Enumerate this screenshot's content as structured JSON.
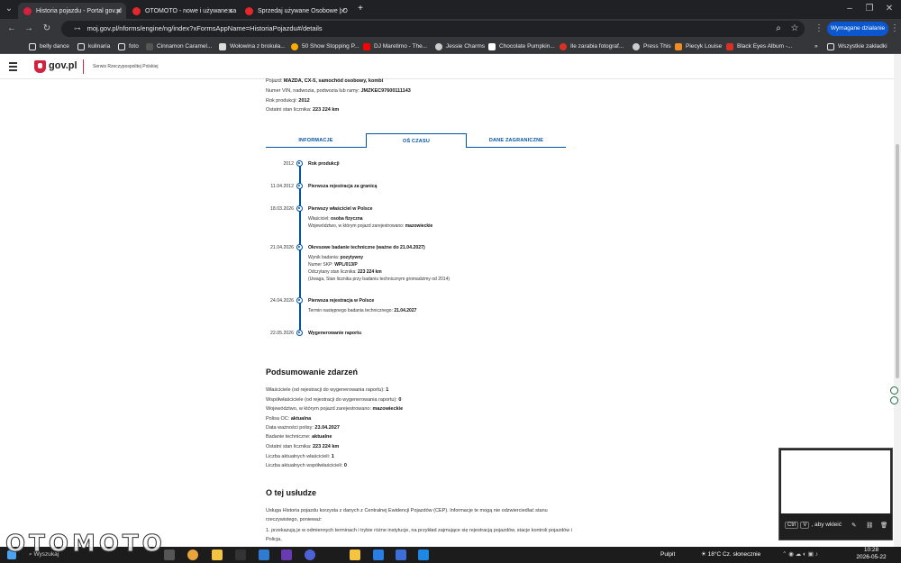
{
  "browser": {
    "tabs": [
      {
        "title": "Historia pojazdu - Portal gov.pl",
        "active": true
      },
      {
        "title": "OTOMOTO - nowe i używane sa",
        "active": false
      },
      {
        "title": "Sprzedaj używane Osobowe | O",
        "active": false
      }
    ],
    "url": "moj.gov.pl/nforms/engine/ng/index?xFormsAppName=HistoriaPojazdu#/details",
    "action_button": "Wymagane działanie",
    "bookmarks": [
      "belly dance",
      "kulinaria",
      "foto",
      "Cinnamon Caramel...",
      "Wołowina z brokuła...",
      "50 Show Stopping P...",
      "DJ Maretimo - The...",
      "Jessie Charms",
      "Chocolate Pumpkin...",
      "Ile zarabia fotograf...",
      "Press This",
      "Piecyk Louise",
      "Black Eyes Album -..."
    ],
    "all_bookmarks": "Wszystkie zakładki"
  },
  "site": {
    "logo": "gov.pl",
    "subtitle": "Serwis Rzeczypospolitej Polskiej"
  },
  "vehicle": {
    "vehicle_label": "Pojazd:",
    "vehicle_value": "MAZDA, CX-5, samochód osobowy, kombi",
    "vin_label": "Numer VIN, nadwozia, podwozia lub ramy:",
    "vin_value": "JMZKEC97600111143",
    "year_label": "Rok produkcji:",
    "year_value": "2012",
    "odometer_label": "Ostatni stan licznika:",
    "odometer_value": "223 224 km"
  },
  "page_tabs": [
    "INFORMACJE",
    "OŚ CZASU",
    "DANE ZAGRANICZNE"
  ],
  "timeline": [
    {
      "date": "2012",
      "title": "Rok produkcji",
      "details": []
    },
    {
      "date": "11.04.2012",
      "title": "Pierwsza rejestracja za granicą",
      "details": []
    },
    {
      "date": "18.03.2026",
      "title": "Pierwszy właściciel w Polsce",
      "details": [
        {
          "label": "Właściciel:",
          "value": "osoba fizyczna"
        },
        {
          "label": "Województwo, w którym pojazd zarejestrowano:",
          "value": "mazowieckie"
        }
      ]
    },
    {
      "date": "21.04.2026",
      "title": "Okresowe badanie techniczne (ważne do 21.04.2027)",
      "details": [
        {
          "label": "Wynik badania:",
          "value": "pozytywny"
        },
        {
          "label": "Numer SKP:",
          "value": "WPL/013/P"
        },
        {
          "label": "Odczytany stan licznika:",
          "value": "223 224 km"
        },
        {
          "label": "(Uwaga, Stan licznika przy badaniu technicznym gromadzimy od 2014)",
          "value": ""
        }
      ]
    },
    {
      "date": "24.04.2026",
      "title": "Pierwsza rejestracja w Polsce",
      "details": [
        {
          "label": "Termin następnego badania technicznego:",
          "value": "21.04.2027"
        }
      ]
    },
    {
      "date": "22.05.2026",
      "title": "Wygenerowanie raportu",
      "details": []
    }
  ],
  "summary": {
    "heading": "Podsumowanie zdarzeń",
    "rows": [
      {
        "label": "Właściciele (od rejestracji do wygenerowania raportu):",
        "value": "1"
      },
      {
        "label": "Współwłaściciele (od rejestracji do wygenerowania raportu):",
        "value": "0"
      },
      {
        "label": "Województwo, w którym pojazd zarejestrowano:",
        "value": "mazowieckie"
      },
      {
        "label": "Polisa OC:",
        "value": "aktualna"
      },
      {
        "label": "Data ważności polisy:",
        "value": "23.04.2027"
      },
      {
        "label": "Badanie techniczne:",
        "value": "aktualne"
      },
      {
        "label": "Ostatni stan licznika:",
        "value": "223 224 km"
      },
      {
        "label": "Liczba aktualnych właścicieli:",
        "value": "1"
      },
      {
        "label": "Liczba aktualnych współwłaścicieli:",
        "value": "0"
      }
    ]
  },
  "about": {
    "heading": "O tej usłudze",
    "p1": "Usługa Historia pojazdu korzysta z danych z Centralnej Ewidencji Pojazdów (CEP). Informacje te mogą nie odzwierciedlać stanu rzeczywistego, ponieważ:",
    "p2": "1. przekazują je w odmiennych terminach i trybie różne instytucje, na przykład zajmujące się rejestracją pojazdów, stacje kontroli pojazdów i Policja,"
  },
  "overlay": {
    "key1": "Ctrl",
    "key2": "V",
    "text": ", aby wkleić"
  },
  "taskbar": {
    "search": "Wyszukaj",
    "desktop": "Pulpit",
    "weather": "18°C  Cz. słonecznie",
    "time": "10:28",
    "date": "2026-05-22"
  },
  "watermark": "OTOMOTO",
  "colors": {
    "accent": "#0052a5",
    "gov_red": "#d4213d",
    "action_blue": "#0b57d0"
  }
}
